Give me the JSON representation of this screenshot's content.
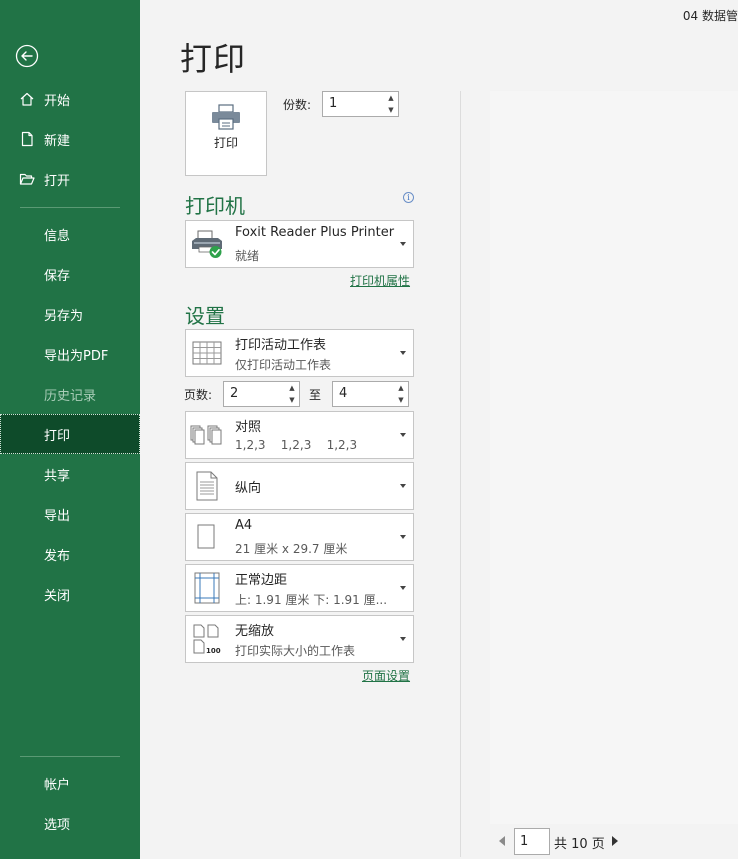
{
  "window": {
    "doc_title": "04 数据管"
  },
  "sidebar": {
    "back_icon": "back-arrow-icon",
    "items": [
      {
        "label": "开始",
        "icon": "home-icon"
      },
      {
        "label": "新建",
        "icon": "new-file-icon"
      },
      {
        "label": "打开",
        "icon": "open-folder-icon"
      },
      {
        "label": "信息"
      },
      {
        "label": "保存"
      },
      {
        "label": "另存为"
      },
      {
        "label": "导出为PDF"
      },
      {
        "label": "历史记录",
        "state": "disabled"
      },
      {
        "label": "打印",
        "state": "active"
      },
      {
        "label": "共享"
      },
      {
        "label": "导出"
      },
      {
        "label": "发布"
      },
      {
        "label": "关闭"
      }
    ],
    "bottom_items": [
      {
        "label": "帐户"
      },
      {
        "label": "选项"
      }
    ]
  },
  "main": {
    "title": "打印",
    "print_button": {
      "label": "打印",
      "icon": "printer-icon"
    },
    "copies": {
      "label": "份数:",
      "value": "1"
    },
    "printer_section": {
      "heading": "打印机",
      "info_icon": "info-icon",
      "selected": {
        "name": "Foxit Reader Plus Printer",
        "status": "就绪",
        "icon": "printer-ready-icon"
      },
      "properties_link": "打印机属性"
    },
    "settings_section": {
      "heading": "设置",
      "what_to_print": {
        "title": "打印活动工作表",
        "subtitle": "仅打印活动工作表",
        "icon": "sheet-grid-icon"
      },
      "pages": {
        "label": "页数:",
        "from": "2",
        "to_label": "至",
        "to": "4"
      },
      "collation": {
        "title": "对照",
        "subtitle": "1,2,3    1,2,3    1,2,3",
        "icon": "collate-icon"
      },
      "orientation": {
        "title": "纵向",
        "icon": "portrait-page-icon"
      },
      "paper_size": {
        "title": "A4",
        "subtitle": "21 厘米 x 29.7 厘米",
        "icon": "paper-size-icon"
      },
      "margins": {
        "title": "正常边距",
        "subtitle": "上: 1.91 厘米 下: 1.91 厘...",
        "icon": "margins-icon"
      },
      "scaling": {
        "title": "无缩放",
        "subtitle": "打印实际大小的工作表",
        "icon": "no-scaling-icon"
      },
      "page_setup_link": "页面设置"
    },
    "pager": {
      "current": "1",
      "total_label": "共 10 页"
    }
  },
  "colors": {
    "accent": "#217346",
    "active_nav": "#0e4b2a"
  }
}
